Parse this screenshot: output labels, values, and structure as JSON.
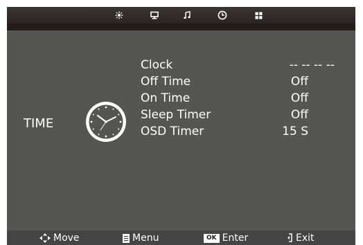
{
  "topbar": {
    "tabs": [
      {
        "icon": "picture-icon"
      },
      {
        "icon": "monitor-icon"
      },
      {
        "icon": "music-note-icon"
      },
      {
        "icon": "clock-icon"
      },
      {
        "icon": "lock-icon"
      }
    ],
    "active_tab": "clock-icon"
  },
  "section": {
    "label": "TIME",
    "icon": "clock-icon"
  },
  "menu": {
    "items": [
      {
        "label": "Clock",
        "value": "-- -- -- --"
      },
      {
        "label": "Off Time",
        "value": "Off"
      },
      {
        "label": "On Time",
        "value": "Off"
      },
      {
        "label": "Sleep Timer",
        "value": "Off"
      },
      {
        "label": "OSD Timer",
        "value": "15 S"
      }
    ]
  },
  "footer": {
    "move_label": "Move",
    "menu_label": "Menu",
    "ok_badge": "OK",
    "enter_label": "Enter",
    "exit_label": "Exit"
  },
  "colors": {
    "panel_bg": "#555554",
    "topbar_bg": "#2a2422",
    "footer_bg": "#444444",
    "text": "#ffffff"
  }
}
